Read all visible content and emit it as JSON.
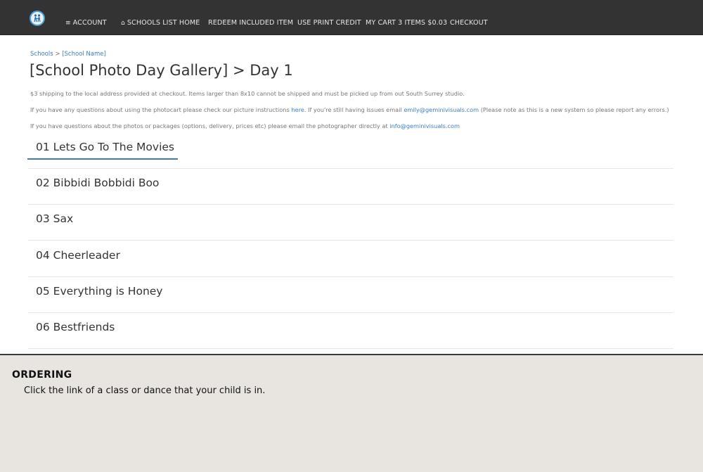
{
  "nav": {
    "logo_icon": "gemini-logo-icon",
    "account": "ACCOUNT",
    "schools_list_home": "SCHOOLS LIST HOME",
    "redeem_included_item": "REDEEM INCLUDED ITEM",
    "use_print_credit": "USE PRINT CREDIT",
    "my_cart": "MY CART 3 ITEMS $0.03",
    "checkout": "CHECKOUT"
  },
  "breadcrumb": {
    "schools": "Schools",
    "separator": ">",
    "school_name": "[School Name]"
  },
  "page": {
    "title": "[School Photo Day Gallery] > Day 1"
  },
  "info": {
    "shipping": "$3 shipping to the local address provided at checkout. Items larger than 8x10 cannot be shipped and must be picked up from out South Surrey studio.",
    "questions_prefix": "If you have any questions about using the photocart please check our picture instructions ",
    "here_link": "here.",
    "questions_middle": " If you're still having issues email ",
    "support_email": "emily@geminivisuals.com",
    "questions_suffix": " (Please note as this is a new system so please report any errors.)",
    "photographer_prefix": "If you have questions about the photos or packages (options, delivery, prices etc) please email the photographer directly at ",
    "photographer_email": "info@geminivisuals.com"
  },
  "classes": [
    {
      "label": "01 Lets Go To The Movies"
    },
    {
      "label": "02 Bibbidi Bobbidi Boo"
    },
    {
      "label": "03 Sax"
    },
    {
      "label": "04 Cheerleader"
    },
    {
      "label": "05 Everything is Honey"
    },
    {
      "label": "06 Bestfriends"
    }
  ],
  "footer": {
    "heading": "ORDERING",
    "text": "Click the link of a class or dance that your child is in."
  },
  "colors": {
    "navbar": "#333333",
    "link": "#3a7fc4",
    "active_underline": "#3a7fa9",
    "footer_bg": "#e8e5e1"
  }
}
